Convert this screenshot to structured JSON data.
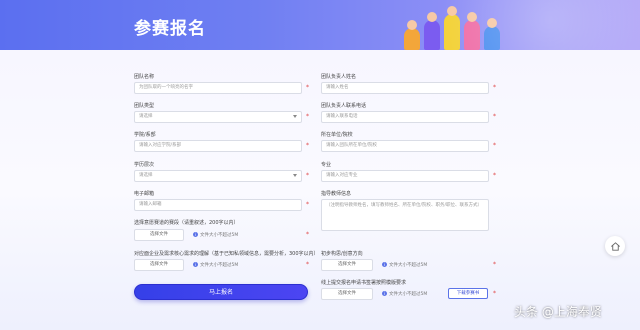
{
  "header": {
    "title": "参赛报名"
  },
  "form": {
    "team_name": {
      "label": "团队名称",
      "placeholder": "为团队取的一个响亮的名字"
    },
    "team_type": {
      "label": "团队类型",
      "value": "请选择"
    },
    "school": {
      "label": "学院/系部",
      "placeholder": "请输入对应学院/系部"
    },
    "grade": {
      "label": "学历层次",
      "value": "请选择"
    },
    "email": {
      "label": "电子邮箱",
      "placeholder": "请输入邮箱"
    },
    "track": {
      "label": "选择意愿赛道的赛段（请重叙述，200字以内）",
      "button": "选择文件",
      "hint": "文件大小不超过5M"
    },
    "proposal": {
      "label": "对应面企业及需求核心需求的理解（基于已知私领域信息，需要分析，300字以内）",
      "button": "选择文件",
      "hint": "文件大小不超过5M"
    },
    "leader_name": {
      "label": "团队负责人姓名",
      "placeholder": "请输入姓名"
    },
    "leader_phone": {
      "label": "团队负责人联系电话",
      "placeholder": "请输入联系电话"
    },
    "unit": {
      "label": "所在单位/院校",
      "placeholder": "请输入团队所在单位/院校"
    },
    "major": {
      "label": "专业",
      "placeholder": "请输入对应专业"
    },
    "mentor": {
      "label": "指导教师信息",
      "placeholder": "（注明指导教师姓名，填写教师姓名、所在单位/院校、职务/职位、联系方式）"
    },
    "work_direction": {
      "label": "初步构思/创意方向",
      "button": "选择文件",
      "hint": "文件大小不超过5M"
    },
    "commitment": {
      "label": "线上提交报名申请书签署按照模版要求",
      "button": "选择文件",
      "hint": "文件大小不超过5M",
      "download": "下载参赛书"
    },
    "submit": "马上报名"
  },
  "watermark": "头条 @上海奉贤",
  "colors": {
    "accent": "#3540e8",
    "banner": "#6f7ff2",
    "required": "#e04646"
  },
  "icons": [
    "chevron-down-icon",
    "info-icon",
    "home-icon"
  ]
}
